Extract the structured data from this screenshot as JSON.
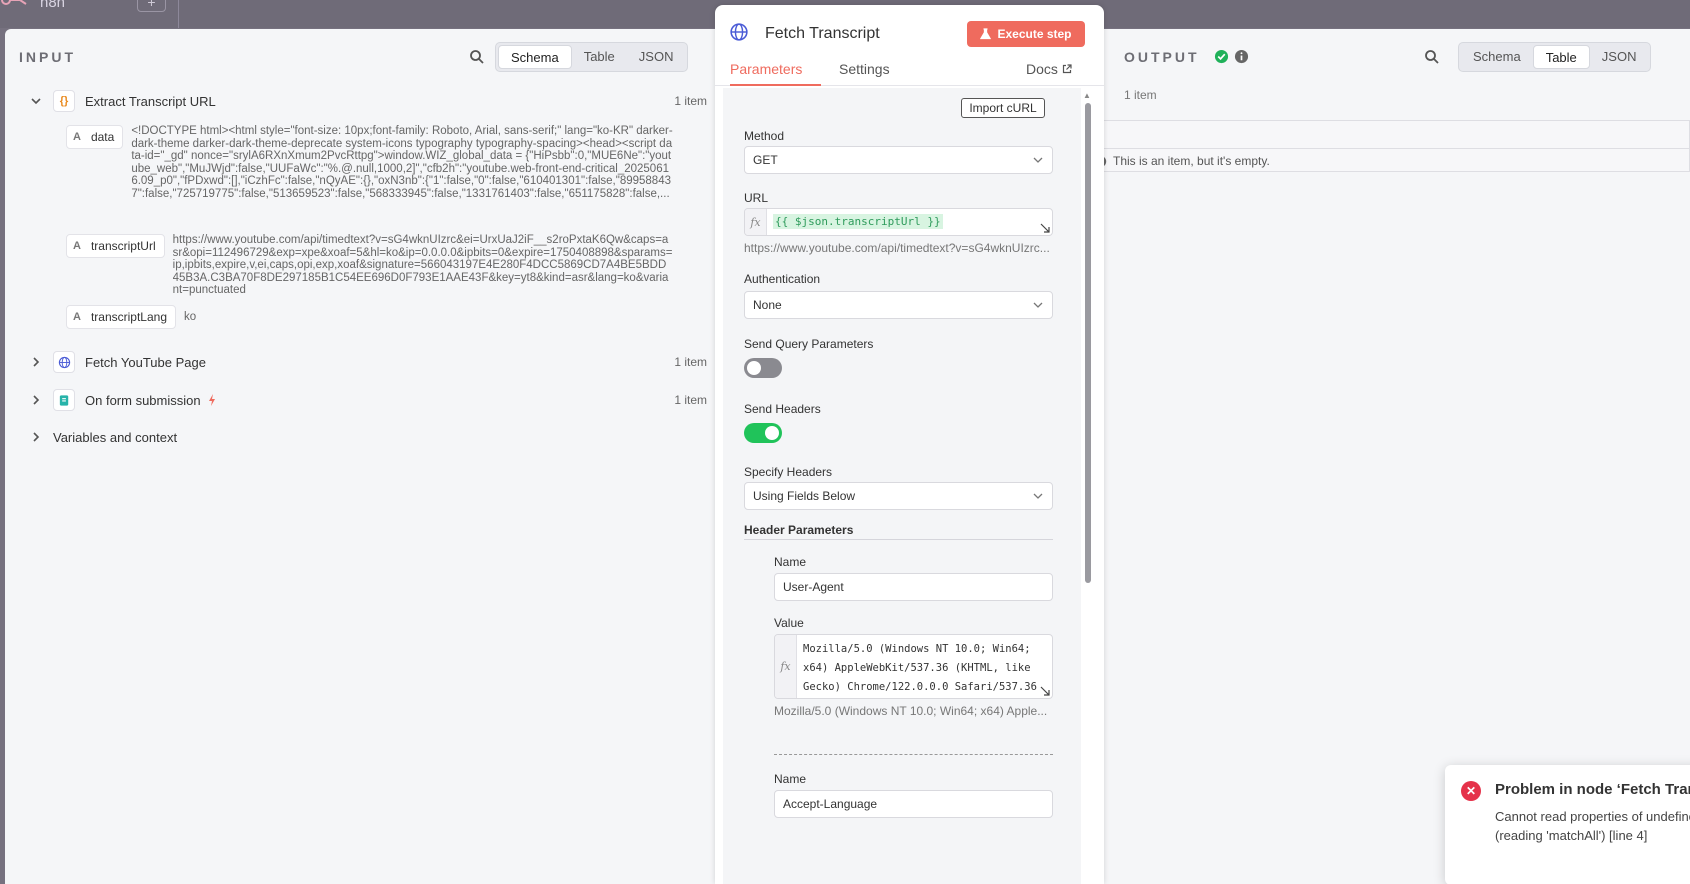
{
  "canvas": {
    "app_name": "n8n"
  },
  "input": {
    "title": "INPUT",
    "views": [
      "Schema",
      "Table",
      "JSON"
    ],
    "active_view": "Schema",
    "nodes": [
      {
        "label": "Extract Transcript URL",
        "count": "1 item",
        "icon": "braces-icon",
        "expanded": true
      },
      {
        "label": "Fetch YouTube Page",
        "count": "1 item",
        "icon": "globe-icon"
      },
      {
        "label": "On form submission",
        "count": "1 item",
        "icon": "form-icon"
      }
    ],
    "fields": [
      {
        "key": "data",
        "value": "<!DOCTYPE html><html style=\"font-size: 10px;font-family: Roboto, Arial, sans-serif;\" lang=\"ko-KR\" darker-dark-theme darker-dark-theme-deprecate system-icons typography typography-spacing><head><script data-id=\"_gd\" nonce=\"srylA6RXnXmum2PvcRttpg\">window.WIZ_global_data = {\"HiPsbb\":0,\"MUE6Ne\":\"youtube_web\",\"MuJWjd\":false,\"UUFaWc\":\"%.@.null,1000,2]\",\"cfb2h\":\"youtube.web-front-end-critical_20250616.09_p0\",\"fPDxwd\":[],\"iCzhFc\":false,\"nQyAE\":{},\"oxN3nb\":{\"1\":false,\"0\":false,\"610401301\":false,\"899588437\":false,\"725719775\":false,\"513659523\":false,\"568333945\":false,\"1331761403\":false,\"651175828\":false,..."
      },
      {
        "key": "transcriptUrl",
        "value": "https://www.youtube.com/api/timedtext?v=sG4wknUIzrc&ei=UrxUaJ2iF__s2roPxtaK6Qw&caps=asr&opi=112496729&exp=xpe&xoaf=5&hl=ko&ip=0.0.0.0&ipbits=0&expire=1750408898&sparams=ip,ipbits,expire,v,ei,caps,opi,exp,xoaf&signature=566043197E4E280F4DCC5869CD7A4BE5BDD45B3A.C3BA70F8DE297185B1C54EE696D0F793E1AAE43F&key=yt8&kind=asr&lang=ko&variant=punctuated"
      },
      {
        "key": "transcriptLang",
        "value": "ko"
      }
    ],
    "variables_label": "Variables and context"
  },
  "node": {
    "title": "Fetch Transcript",
    "execute_label": "Execute step",
    "tabs": [
      "Parameters",
      "Settings"
    ],
    "docs_label": "Docs",
    "import_curl": "Import cURL",
    "method_label": "Method",
    "method_value": "GET",
    "url_label": "URL",
    "url_expression": "{{ $json.transcriptUrl }}",
    "url_preview": "https://www.youtube.com/api/timedtext?v=sG4wknUIzrc...",
    "auth_label": "Authentication",
    "auth_value": "None",
    "send_query_label": "Send Query Parameters",
    "send_query_on": false,
    "send_headers_label": "Send Headers",
    "send_headers_on": true,
    "specify_headers_label": "Specify Headers",
    "specify_headers_value": "Using Fields Below",
    "header_params_label": "Header Parameters",
    "headers": [
      {
        "name_label": "Name",
        "name_value": "User-Agent",
        "value_label": "Value",
        "value_lines": [
          "Mozilla/5.0 (Windows NT 10.0; Win64;",
          "x64) AppleWebKit/537.36 (KHTML, like",
          "Gecko) Chrome/122.0.0.0 Safari/537.36"
        ],
        "value_preview": "Mozilla/5.0 (Windows NT 10.0; Win64; x64) Apple..."
      },
      {
        "name_label": "Name",
        "name_value": "Accept-Language"
      }
    ]
  },
  "output": {
    "title": "OUTPUT",
    "views": [
      "Schema",
      "Table",
      "JSON"
    ],
    "active_view": "Table",
    "count": "1 item",
    "empty_message": "This is an item, but it's empty."
  },
  "toast": {
    "title": "Problem in node ‘Fetch Transcript‘",
    "message_line1": "Cannot read properties of undefined",
    "message_line2": "(reading 'matchAll') [line 4]"
  },
  "colors": {
    "accent": "#ef6b5e",
    "success": "#20b15a",
    "error": "#e5324a",
    "toggle_on": "#20c35a"
  }
}
